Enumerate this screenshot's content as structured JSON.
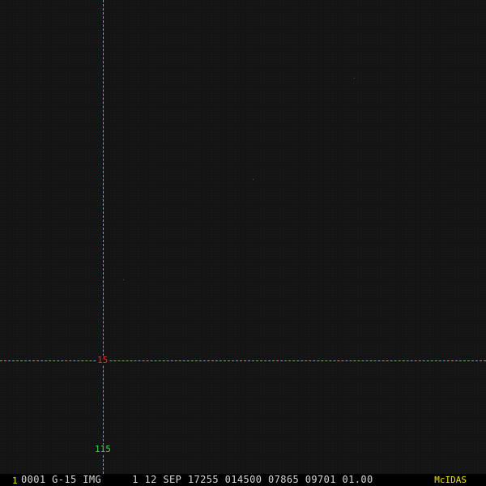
{
  "colors": {
    "background": "#141414",
    "grid_line": "#00d0e0",
    "latitude_label": "#e03030",
    "longitude_label": "#30e030",
    "status_text": "#d8d8d8",
    "frame_number": "#f0e000",
    "brand": "#f0e000"
  },
  "grid": {
    "latitude_label": "15",
    "longitude_label": "115"
  },
  "status_bar": {
    "frame_number": "1",
    "text": "0001 G-15 IMG     1 12 SEP 17255 014500 07865 09701 01.00",
    "brand": "McIDAS"
  }
}
